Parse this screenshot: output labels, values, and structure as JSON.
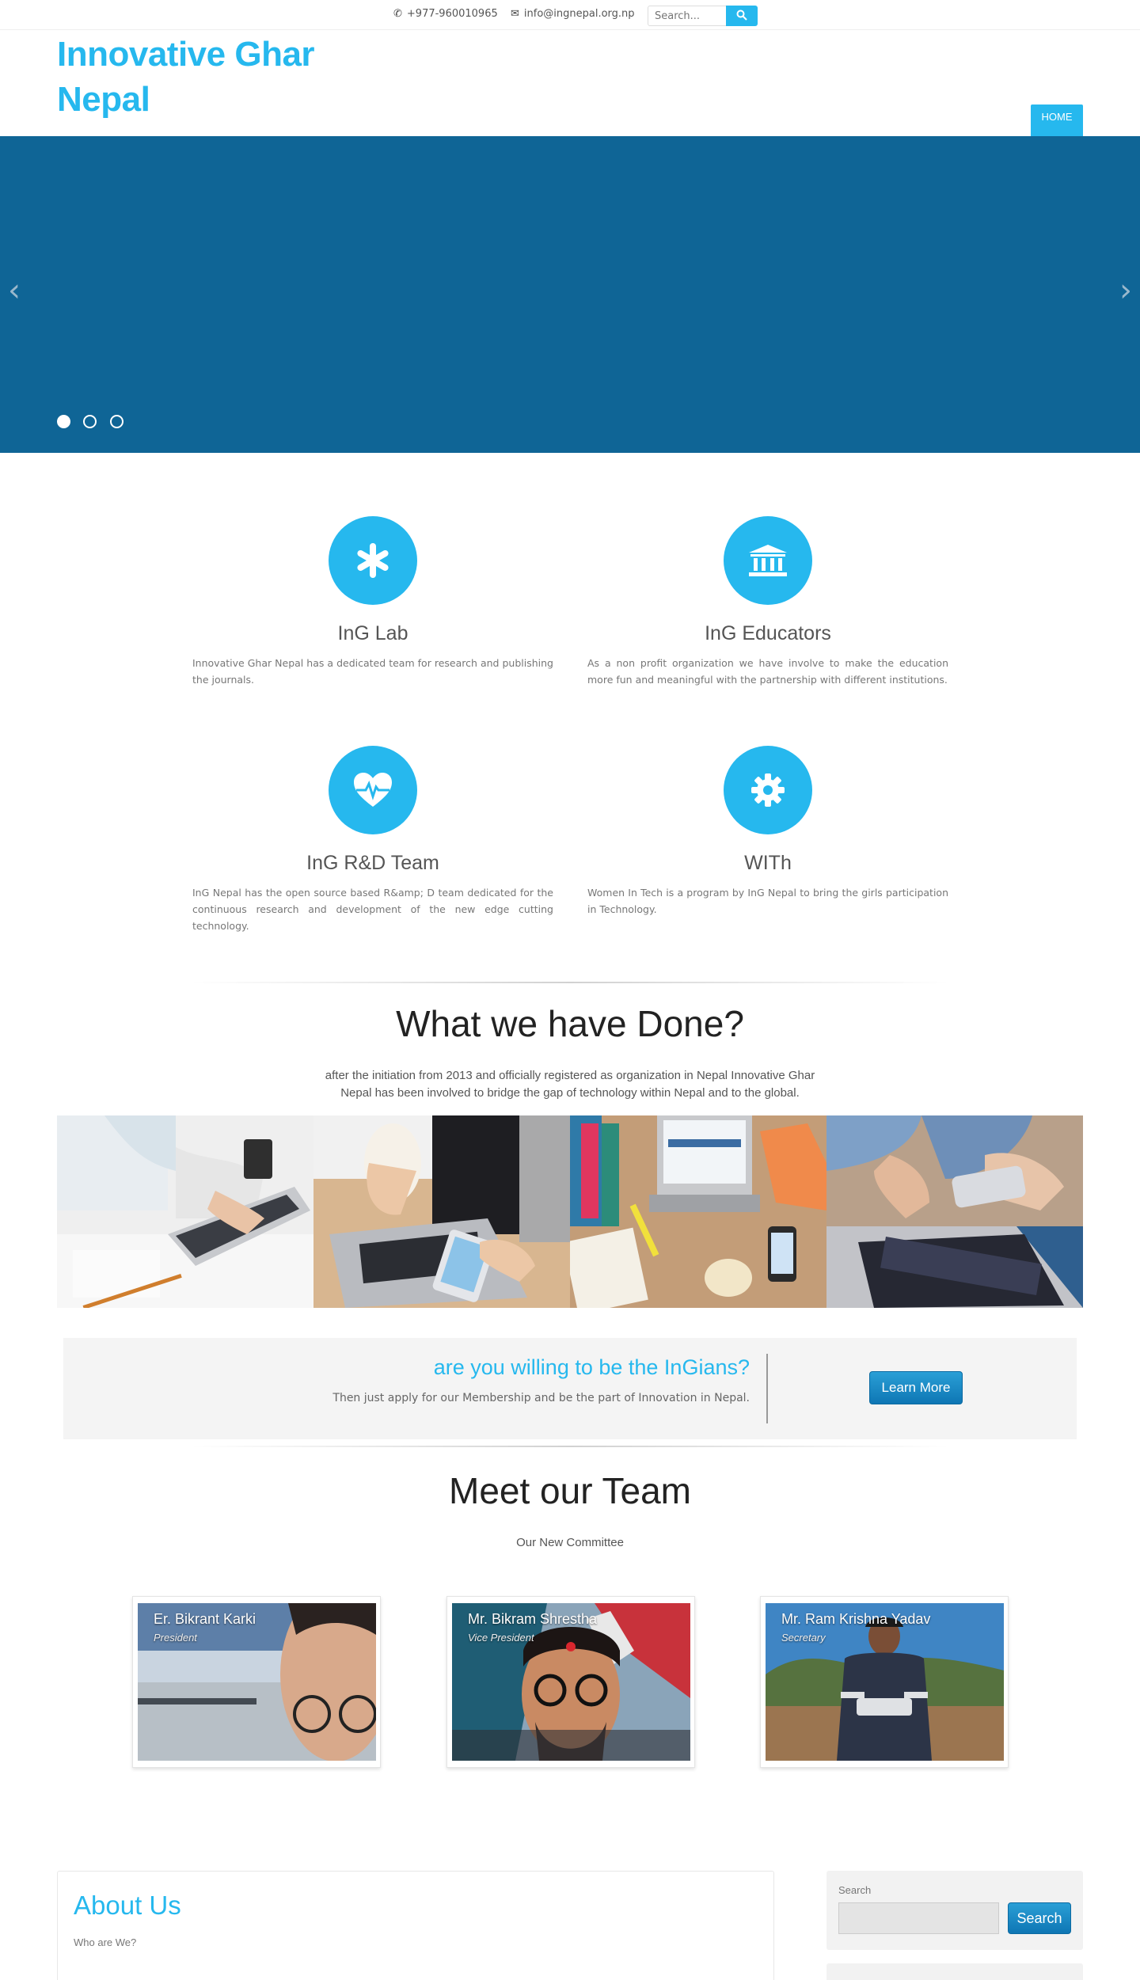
{
  "topbar": {
    "phone": "+977-960010965",
    "email": "info@ingnepal.org.np",
    "search_placeholder": "Search..."
  },
  "header": {
    "title_line1": "Innovative Ghar",
    "title_line2": "Nepal",
    "nav_home": "HOME"
  },
  "slider": {
    "prev": "‹",
    "next": "›",
    "slides": 3,
    "active_slide": 1
  },
  "features": [
    {
      "title": "InG Lab",
      "text": "Innovative Ghar Nepal has a dedicated team for research and publishing the journals.",
      "icon": "asterisk-icon"
    },
    {
      "title": "InG Educators",
      "text": "As a non profit organization we have involve to make the education more fun and meaningful with the partnership with different institutions.",
      "icon": "institution-icon"
    },
    {
      "title": "InG R&D Team",
      "text": "InG Nepal has the open source based R&amp; D team dedicated for the continuous research and development of the new edge cutting technology.",
      "icon": "heartbeat-icon"
    },
    {
      "title": "WITh",
      "text": "Women In Tech is a program by InG Nepal to bring the girls participation in Technology.",
      "icon": "gear-icon"
    }
  ],
  "done": {
    "title": "What we have Done?",
    "text": "after the initiation from 2013 and officially registered as organization in Nepal Innovative Ghar Nepal has been involved to bridge the gap of technology within Nepal and to the global."
  },
  "cta": {
    "title": "are you willing to be the InGians?",
    "text": "Then just apply for our Membership and be the part of Innovation in Nepal.",
    "button": "Learn More"
  },
  "team": {
    "title": "Meet our Team",
    "subtitle": "Our New Committee",
    "members": [
      {
        "name": "Er. Bikrant Karki",
        "role": "President"
      },
      {
        "name": "Mr. Bikram Shrestha",
        "role": "Vice President"
      },
      {
        "name": "Mr. Ram Krishna Yadav",
        "role": "Secretary"
      }
    ]
  },
  "about": {
    "title": "About Us",
    "subtitle": "Who are We?"
  },
  "sidebar": {
    "search_label": "Search",
    "search_button": "Search"
  },
  "colors": {
    "accent": "#26b8ee",
    "slider_bg": "#0f6596"
  }
}
